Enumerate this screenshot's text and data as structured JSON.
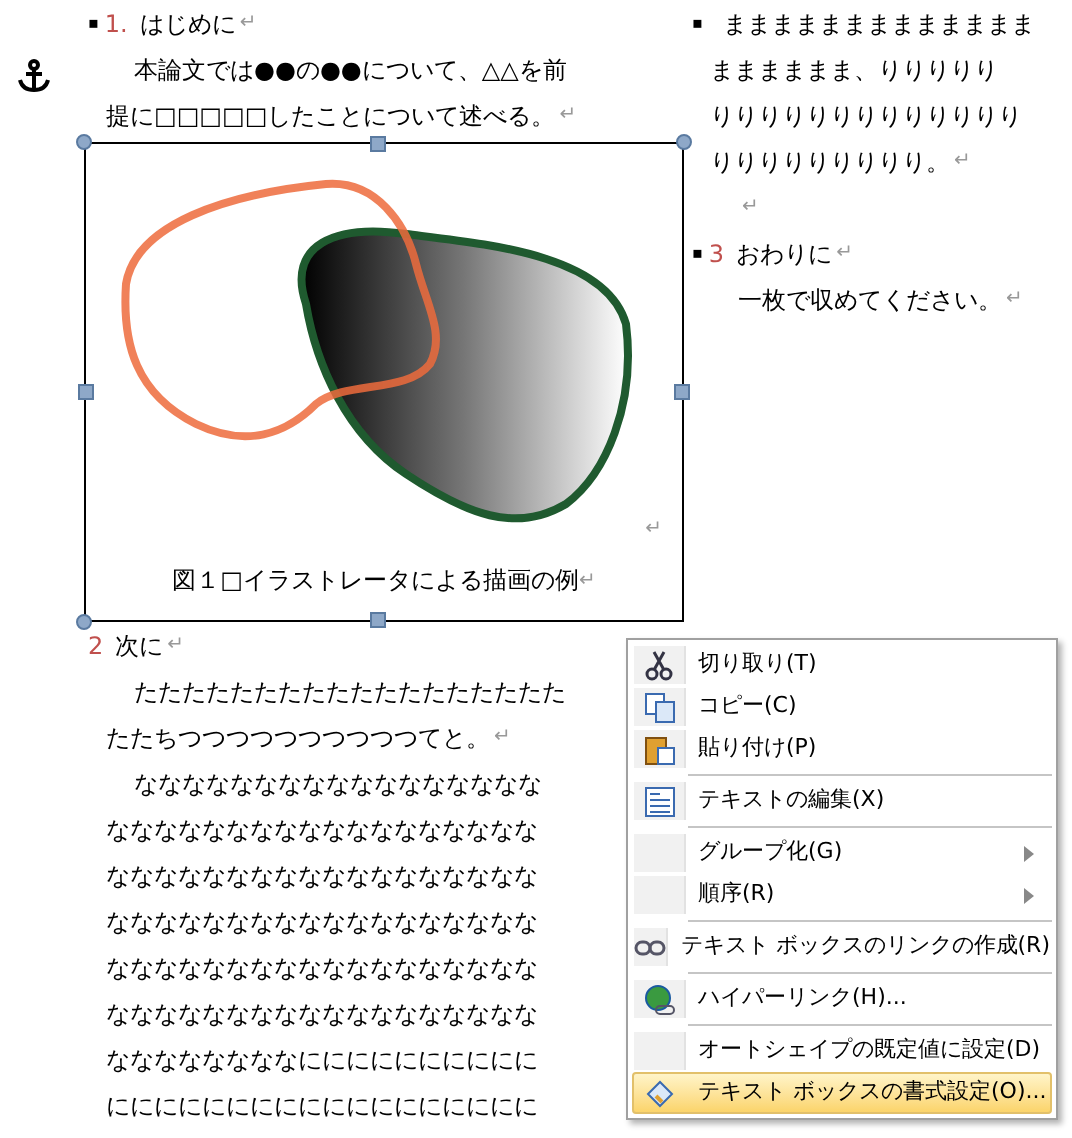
{
  "left_column": {
    "lines_above": [
      {
        "kind": "heading",
        "bullet": "▪",
        "number": "1.",
        "text": "はじめに",
        "mark": "↵"
      },
      {
        "kind": "indent",
        "text": "本論文では●●の●●について、△△を前"
      },
      {
        "kind": "plain",
        "text": "提に□□□□□したことについて述べる。",
        "mark": "↵"
      }
    ],
    "text_box": {
      "drawing_mark": "↵",
      "caption": "図１□イラストレータによる描画の例",
      "caption_mark": "↵",
      "selected": true
    },
    "lines_below": [
      {
        "kind": "heading",
        "number": "2",
        "text": "次に",
        "mark": "↵"
      },
      {
        "kind": "indent",
        "text": "たたたたたたたたたたたたたたたたたた"
      },
      {
        "kind": "plain",
        "text": "たたちつつつつつつつつつつてと。",
        "mark": "↵"
      },
      {
        "kind": "indent",
        "text": "ななななななななななななななななな"
      },
      {
        "kind": "plain",
        "text": "なななななななななななななななななな"
      },
      {
        "kind": "plain",
        "text": "なななななななななななななななななな"
      },
      {
        "kind": "plain",
        "text": "なななななななななななななななななな"
      },
      {
        "kind": "plain",
        "text": "なななななななななななななななななな"
      },
      {
        "kind": "plain",
        "text": "なななななななななななななななななな"
      },
      {
        "kind": "plain",
        "text": "ななななななななにににににににににに"
      },
      {
        "kind": "plain",
        "text": "にににににににににににににににににに"
      }
    ]
  },
  "right_column": {
    "lines": [
      {
        "kind": "bullet",
        "bullet": "▪",
        "text": "ままままままままままままま"
      },
      {
        "kind": "plain",
        "text": "まままままま、りりりりり"
      },
      {
        "kind": "plain",
        "text": "りりりりりりりりりりりりり"
      },
      {
        "kind": "plain",
        "text": "りりりりりりりりり。",
        "mark": "↵"
      },
      {
        "kind": "empty",
        "mark": "↵"
      },
      {
        "kind": "heading",
        "bullet": "▪",
        "number": "3",
        "text": "おわりに",
        "mark": "↵"
      },
      {
        "kind": "indent",
        "text": "一枚で収めてください。",
        "mark": "↵"
      }
    ]
  },
  "context_menu": {
    "items": [
      {
        "label": "切り取り(T)",
        "submenu": false,
        "selected": false
      },
      {
        "label": "コピー(C)",
        "submenu": false,
        "selected": false
      },
      {
        "label": "貼り付け(P)",
        "submenu": false,
        "selected": false
      },
      {
        "kind": "separator"
      },
      {
        "label": "テキストの編集(X)",
        "submenu": false,
        "selected": false
      },
      {
        "kind": "separator"
      },
      {
        "label": "グループ化(G)",
        "submenu": true,
        "selected": false
      },
      {
        "label": "順序(R)",
        "submenu": true,
        "selected": false
      },
      {
        "kind": "separator"
      },
      {
        "label": "テキスト ボックスのリンクの作成(R)",
        "submenu": false,
        "selected": false
      },
      {
        "kind": "separator"
      },
      {
        "label": "ハイパーリンク(H)...",
        "submenu": false,
        "selected": false
      },
      {
        "kind": "separator"
      },
      {
        "label": "オートシェイプの既定値に設定(D)",
        "submenu": false,
        "selected": false
      },
      {
        "label": "テキスト ボックスの書式設定(O)...",
        "submenu": false,
        "selected": true
      }
    ]
  }
}
